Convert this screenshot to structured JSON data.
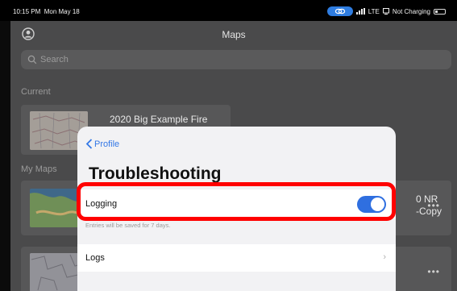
{
  "status_bar": {
    "time": "10:15 PM",
    "date": "Mon May 18",
    "network": "LTE",
    "charging": "Not Charging"
  },
  "app": {
    "title": "Maps",
    "search_placeholder": "Search",
    "section_current": "Current",
    "section_my_maps": "My Maps",
    "current_map": {
      "title": "2020 Big Example Fire"
    },
    "my_maps": [
      {
        "title_line1": "0 NR",
        "title_line2": "-Copy",
        "menu": "•••"
      },
      {
        "menu": "•••"
      }
    ]
  },
  "modal": {
    "back_label": "Profile",
    "title": "Troubleshooting",
    "logging_label": "Logging",
    "logging_enabled": true,
    "logging_footnote": "Entries will be saved for 7 days.",
    "logs_label": "Logs",
    "chevron": "›"
  },
  "colors": {
    "accent": "#2f6fe0",
    "highlight": "#ff0000"
  }
}
